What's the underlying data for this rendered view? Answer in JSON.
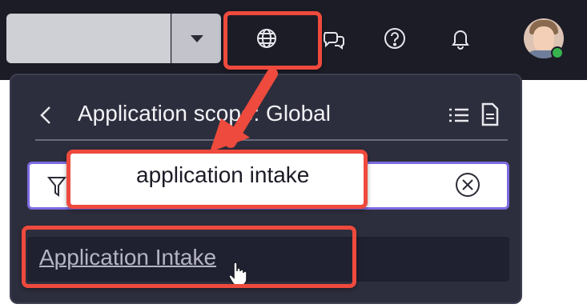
{
  "topbar": {
    "icons": [
      "chevron-down-icon",
      "globe-icon",
      "chat-bubbles-icon",
      "help-icon",
      "bell-icon"
    ],
    "user_status": "online"
  },
  "panel": {
    "title": "Application scope: Global",
    "filter": {
      "value": "application intake",
      "placeholder": ""
    },
    "results": [
      {
        "label": "Application Intake"
      }
    ]
  },
  "colors": {
    "nav_background": "#1b1c26",
    "panel_background": "#2d2e3d",
    "focus_border": "#7d6be0",
    "annotation": "#ee4a3d",
    "status_online": "#37b24d"
  }
}
